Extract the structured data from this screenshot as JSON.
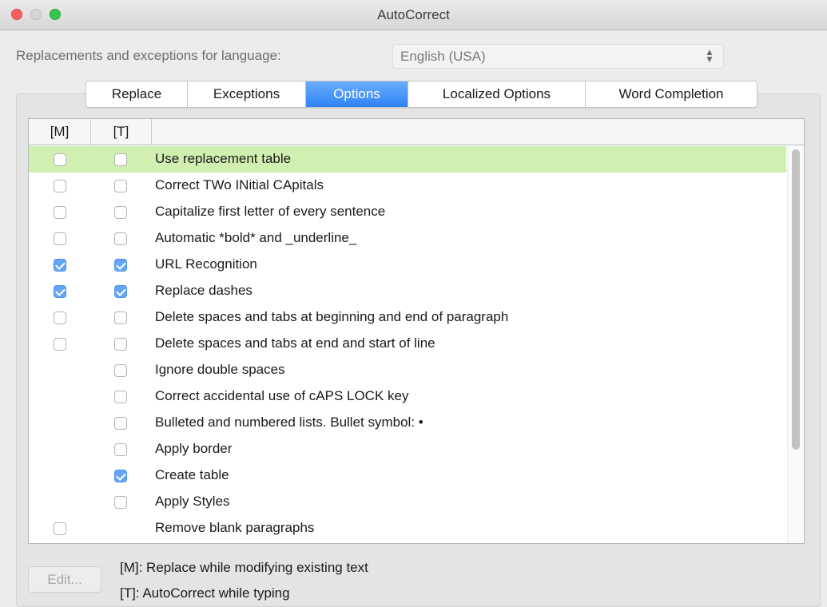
{
  "window": {
    "title": "AutoCorrect"
  },
  "language": {
    "label": "Replacements and exceptions for language:",
    "selected": "English (USA)"
  },
  "tabs": [
    {
      "label": "Replace",
      "active": false
    },
    {
      "label": "Exceptions",
      "active": false
    },
    {
      "label": "Options",
      "active": true
    },
    {
      "label": "Localized Options",
      "active": false
    },
    {
      "label": "Word Completion",
      "active": false
    }
  ],
  "list": {
    "headers": {
      "m": "[M]",
      "t": "[T]",
      "label": ""
    },
    "rows": [
      {
        "label": "Use replacement table",
        "m": false,
        "t": false,
        "selected": true
      },
      {
        "label": "Correct TWo INitial CApitals",
        "m": false,
        "t": false
      },
      {
        "label": "Capitalize first letter of every sentence",
        "m": false,
        "t": false
      },
      {
        "label": "Automatic *bold* and _underline_",
        "m": false,
        "t": false
      },
      {
        "label": "URL Recognition",
        "m": true,
        "t": true
      },
      {
        "label": "Replace dashes",
        "m": true,
        "t": true
      },
      {
        "label": "Delete spaces and tabs at beginning and end of paragraph",
        "m": false,
        "t": false
      },
      {
        "label": "Delete spaces and tabs at end and start of line",
        "m": false,
        "t": false
      },
      {
        "label": "Ignore double spaces",
        "m": null,
        "t": false
      },
      {
        "label": "Correct accidental use of cAPS LOCK key",
        "m": null,
        "t": false
      },
      {
        "label": "Bulleted and numbered lists. Bullet symbol: •",
        "m": null,
        "t": false
      },
      {
        "label": "Apply border",
        "m": null,
        "t": false
      },
      {
        "label": "Create table",
        "m": null,
        "t": true
      },
      {
        "label": "Apply Styles",
        "m": null,
        "t": false
      },
      {
        "label": "Remove blank paragraphs",
        "m": false,
        "t": null
      }
    ]
  },
  "footer": {
    "edit_button": "Edit...",
    "legend_m": "[M]: Replace while modifying existing text",
    "legend_t": "[T]: AutoCorrect while typing"
  },
  "icons": {
    "close": "traffic-light-close-icon",
    "minimize": "traffic-light-minimize-icon",
    "zoom": "traffic-light-zoom-icon",
    "select": "up-down-chevron-icon"
  },
  "colors": {
    "selected_row": "#d0efb0",
    "checkbox_checked": "#62a6f8",
    "active_tab": "#2f83f7"
  }
}
